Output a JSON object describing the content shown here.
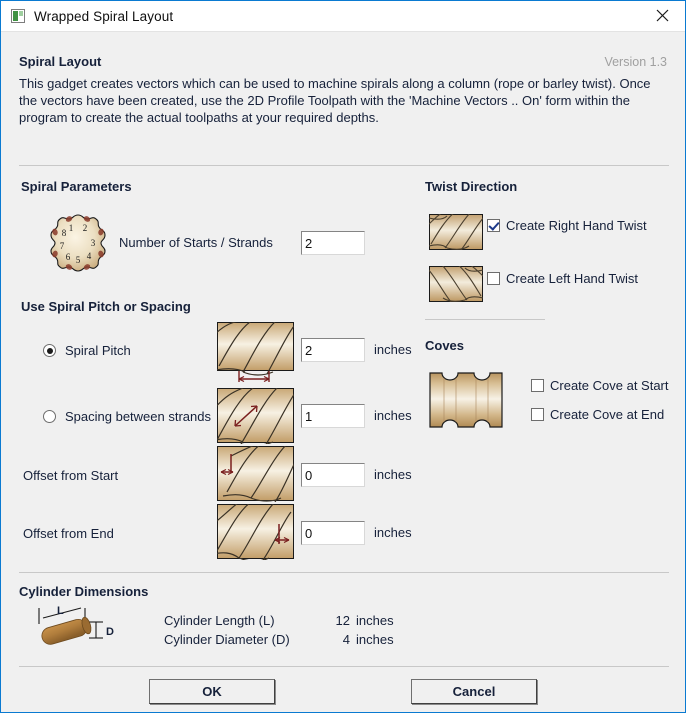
{
  "window": {
    "title": "Wrapped Spiral Layout",
    "app_icon": "spiral-gadget-icon",
    "close_icon": "close-icon",
    "border_color": "#0a7ad1"
  },
  "intro": {
    "heading": "Spiral Layout",
    "version": "Version 1.3",
    "description": "This gadget creates vectors which can be used to machine spirals along a column (rope or barley twist). Once the vectors have been created, use the 2D Profile Toolpath with the 'Machine Vectors .. On' form within the program to create the actual toolpaths at your required depths."
  },
  "spiral_parameters": {
    "heading": "Spiral Parameters",
    "starts_icon": "spiral-starts-circle-icon",
    "starts_label": "Number of Starts / Strands",
    "starts_value": "2",
    "starts_numbers": [
      "1",
      "2",
      "3",
      "4",
      "5",
      "6",
      "7",
      "8"
    ]
  },
  "pitch_spacing": {
    "heading": "Use Spiral Pitch or Spacing",
    "options": [
      {
        "label": "Spiral Pitch",
        "selected": true,
        "icon": "spiral-pitch-preview-icon",
        "value": "2",
        "units": "inches"
      },
      {
        "label": "Spacing between strands",
        "selected": false,
        "icon": "spiral-spacing-preview-icon",
        "value": "1",
        "units": "inches"
      }
    ],
    "offsets": [
      {
        "label": "Offset from Start",
        "icon": "offset-from-start-preview-icon",
        "value": "0",
        "units": "inches"
      },
      {
        "label": "Offset from End",
        "icon": "offset-from-end-preview-icon",
        "value": "0",
        "units": "inches"
      }
    ]
  },
  "twist_direction": {
    "heading": "Twist Direction",
    "items": [
      {
        "label": "Create Right Hand Twist",
        "checked": true,
        "icon": "right-hand-twist-preview-icon"
      },
      {
        "label": "Create Left Hand Twist",
        "checked": false,
        "icon": "left-hand-twist-preview-icon"
      }
    ]
  },
  "coves": {
    "heading": "Coves",
    "icon": "cove-preview-icon",
    "items": [
      {
        "label": "Create Cove at Start",
        "checked": false
      },
      {
        "label": "Create Cove at End",
        "checked": false
      }
    ]
  },
  "cylinder_dimensions": {
    "heading": "Cylinder Dimensions",
    "icon": "cylinder-dimension-icon",
    "icon_labels": {
      "length": "L",
      "diameter": "D"
    },
    "rows": [
      {
        "label": "Cylinder Length (L)",
        "value": "12",
        "units": "inches"
      },
      {
        "label": "Cylinder Diameter (D)",
        "value": "4",
        "units": "inches"
      }
    ]
  },
  "footer": {
    "ok_label": "OK",
    "cancel_label": "Cancel"
  },
  "colors": {
    "wood_light": "#f5ecd8",
    "wood_mid": "#d8bd92",
    "wood_dark": "#b08f5c",
    "dimension_red": "#7a1f1f",
    "accent_blue": "#0a7ad1"
  }
}
